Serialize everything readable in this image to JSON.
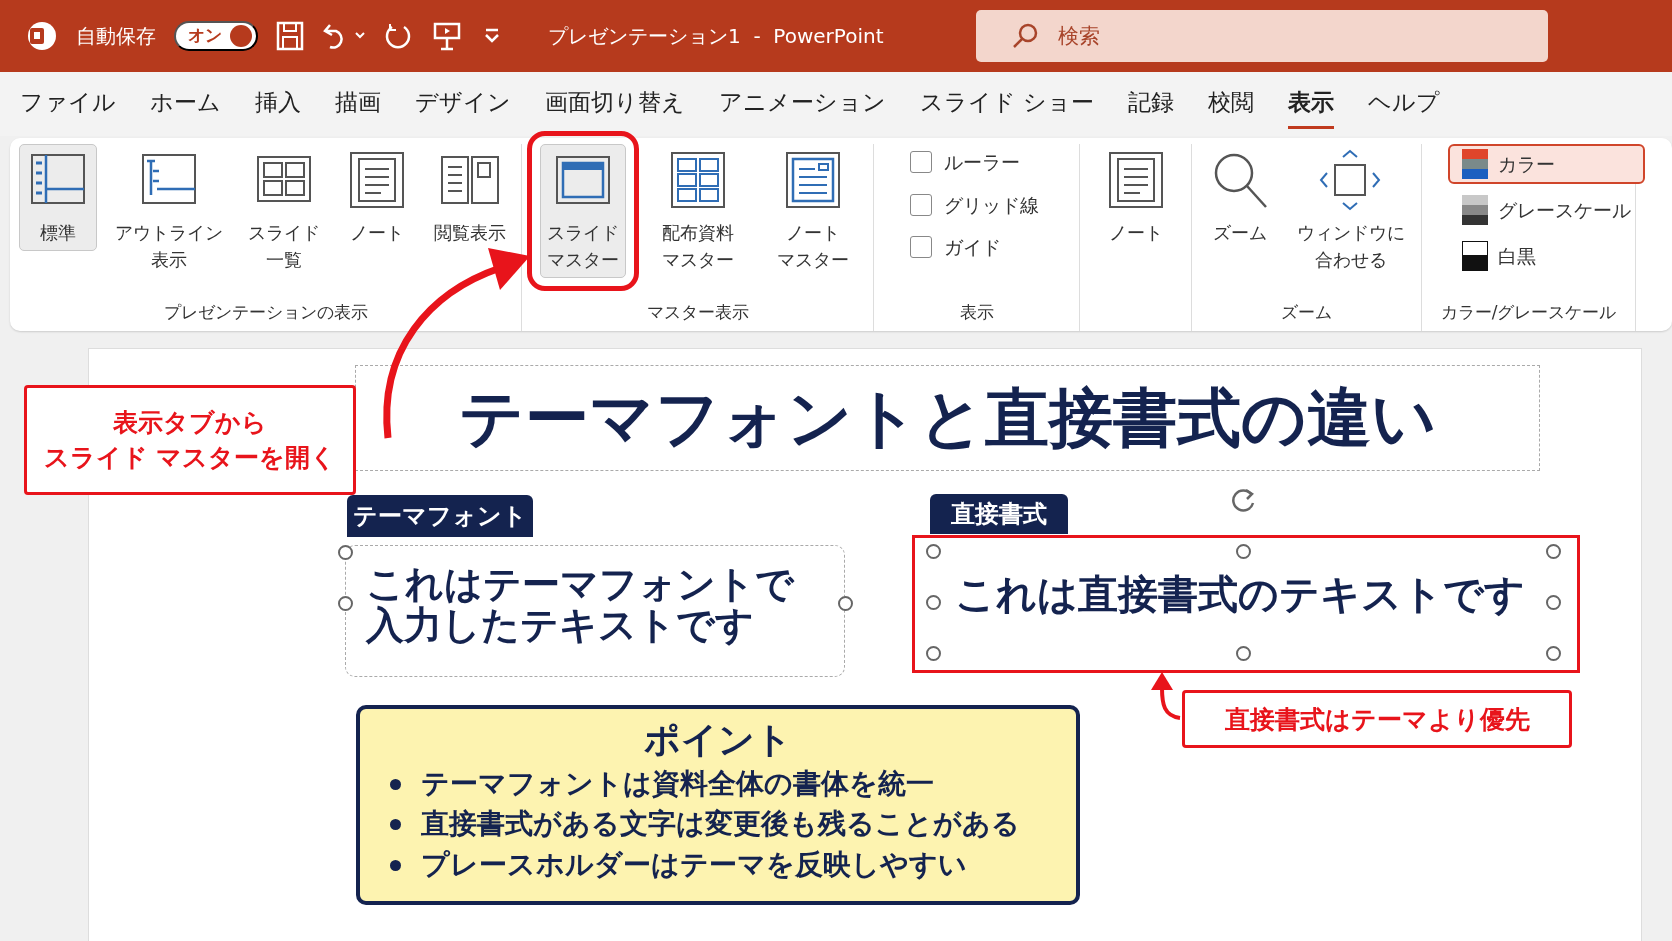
{
  "title_bar": {
    "autosave_label": "自動保存",
    "autosave_toggle": {
      "label": "オン",
      "on": true
    },
    "document_title": "プレゼンテーション1  -  PowerPoint",
    "search": {
      "placeholder": "検索"
    }
  },
  "ribbon_tabs": [
    {
      "label": "ファイル",
      "selected": false
    },
    {
      "label": "ホーム",
      "selected": false
    },
    {
      "label": "挿入",
      "selected": false
    },
    {
      "label": "描画",
      "selected": false
    },
    {
      "label": "デザイン",
      "selected": false
    },
    {
      "label": "画面切り替え",
      "selected": false
    },
    {
      "label": "アニメーション",
      "selected": false
    },
    {
      "label": "スライド ショー",
      "selected": false
    },
    {
      "label": "記録",
      "selected": false
    },
    {
      "label": "校閲",
      "selected": false
    },
    {
      "label": "表示",
      "selected": true
    },
    {
      "label": "ヘルプ",
      "selected": false
    }
  ],
  "ribbon_groups": [
    {
      "label": "プレゼンテーションの表示",
      "items": [
        {
          "kind": "large",
          "label_lines": [
            "標準"
          ],
          "selected": true
        },
        {
          "kind": "large",
          "label_lines": [
            "アウトライン",
            "表示"
          ],
          "selected": false
        },
        {
          "kind": "large",
          "label_lines": [
            "スライド",
            "一覧"
          ],
          "selected": false
        },
        {
          "kind": "large",
          "label_lines": [
            "ノート"
          ],
          "selected": false
        },
        {
          "kind": "large",
          "label_lines": [
            "閲覧表示"
          ],
          "selected": false
        }
      ]
    },
    {
      "label": "マスター表示",
      "items": [
        {
          "kind": "large",
          "label_lines": [
            "スライド",
            "マスター"
          ],
          "selected": true,
          "annotated": true
        },
        {
          "kind": "large",
          "label_lines": [
            "配布資料",
            "マスター"
          ],
          "selected": false
        },
        {
          "kind": "large",
          "label_lines": [
            "ノート",
            "マスター"
          ],
          "selected": false
        }
      ]
    },
    {
      "label": "表示",
      "items": [
        {
          "kind": "checkbox",
          "label": "ルーラー",
          "checked": false
        },
        {
          "kind": "checkbox",
          "label": "グリッド線",
          "checked": false
        },
        {
          "kind": "checkbox",
          "label": "ガイド",
          "checked": false
        }
      ]
    },
    {
      "items": [
        {
          "kind": "large",
          "label_lines": [
            "ノート"
          ],
          "selected": false
        }
      ]
    },
    {
      "label": "ズーム",
      "items": [
        {
          "kind": "large",
          "label_lines": [
            "ズーム"
          ],
          "selected": false
        },
        {
          "kind": "large",
          "label_lines": [
            "ウィンドウに",
            "合わせる"
          ],
          "selected": false
        }
      ]
    },
    {
      "label": "カラー/グレースケール",
      "items": [
        {
          "kind": "small",
          "label": "カラー",
          "selected": true
        },
        {
          "kind": "small",
          "label": "グレースケール",
          "selected": false
        },
        {
          "kind": "small",
          "label": "白黒",
          "selected": false
        }
      ]
    }
  ],
  "slide": {
    "title": "テーマフォントと直接書式の違い",
    "text_boxes": [
      {
        "tag": "テーマフォント",
        "text_lines": [
          "これはテーマフォントで",
          "入力したテキストです"
        ],
        "selected": false
      },
      {
        "tag": "直接書式",
        "text_lines": [
          "これは直接書式のテキストです"
        ],
        "selected": true,
        "annotated": true
      }
    ],
    "point_box": {
      "heading": "ポイント",
      "bullets": [
        "テーマフォントは資料全体の書体を統一",
        "直接書式がある文字は変更後も残ることがある",
        "プレースホルダーはテーマを反映しやすい"
      ]
    }
  },
  "annotations": [
    {
      "text_lines": [
        "表示タブから",
        "スライド マスターを開く"
      ]
    },
    {
      "text_lines": [
        "直接書式はテーマより優先"
      ]
    }
  ]
}
